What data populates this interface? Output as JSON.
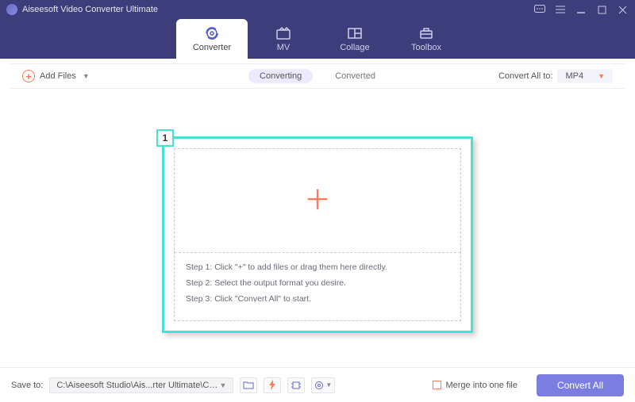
{
  "app": {
    "title": "Aiseesoft Video Converter Ultimate"
  },
  "tabs": {
    "converter": "Converter",
    "mv": "MV",
    "collage": "Collage",
    "toolbox": "Toolbox"
  },
  "toolbar": {
    "add_files": "Add Files",
    "converting": "Converting",
    "converted": "Converted",
    "convert_all_to": "Convert All to:",
    "format": "MP4"
  },
  "highlight": {
    "badge": "1"
  },
  "steps": {
    "s1": "Step 1: Click \"+\" to add files or drag them here directly.",
    "s2": "Step 2: Select the output format you desire.",
    "s3": "Step 3: Click \"Convert All\" to start."
  },
  "footer": {
    "save_to": "Save to:",
    "path": "C:\\Aiseesoft Studio\\Ais...rter Ultimate\\Converted",
    "merge": "Merge into one file",
    "convert_all": "Convert All"
  }
}
